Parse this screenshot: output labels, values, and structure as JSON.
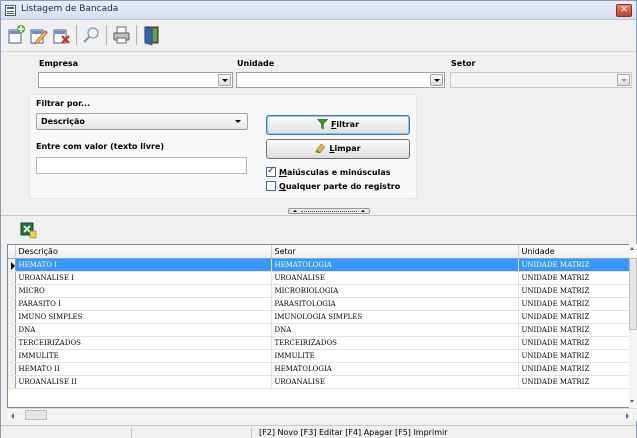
{
  "window": {
    "title": "Listagem de Bancada",
    "close_label": "✕"
  },
  "toolbar": {
    "buttons": [
      {
        "icon": "new-record-icon"
      },
      {
        "icon": "edit-record-icon"
      },
      {
        "icon": "delete-record-icon"
      },
      {
        "icon": "search-icon"
      },
      {
        "icon": "print-icon"
      },
      {
        "icon": "exit-door-icon"
      }
    ]
  },
  "filters": {
    "empresa_label": "Empresa",
    "unidade_label": "Unidade",
    "setor_label": "Setor",
    "empresa_value": "",
    "unidade_value": "",
    "setor_value": ""
  },
  "filter_panel": {
    "filtrar_por_label": "Filtrar por...",
    "filtrar_por_value": "Descrição",
    "valor_label": "Entre com valor (texto livre)",
    "valor_value": "",
    "filtrar_button": {
      "mnemonic": "F",
      "rest": "iltrar"
    },
    "limpar_button": {
      "mnemonic": "L",
      "rest": "impar"
    },
    "case_checkbox": {
      "mnemonic": "M",
      "rest": "aiúsculas e minúsculas",
      "checked": true
    },
    "anypart_checkbox": {
      "mnemonic": "Q",
      "rest": "ualquer parte do registro",
      "checked": false
    }
  },
  "grid": {
    "columns": [
      "Descrição",
      "Setor",
      "Unidade"
    ],
    "rows": [
      [
        "HEMATO I",
        "HEMATOLOGIA",
        "UNIDADE MATRIZ"
      ],
      [
        "UROANALISE I",
        "UROANALISE",
        "UNIDADE MATRIZ"
      ],
      [
        "MICRO",
        "MICROBIOLOGIA",
        "UNIDADE MATRIZ"
      ],
      [
        "PARASITO I",
        "PARASITOLOGIA",
        "UNIDADE MATRIZ"
      ],
      [
        "IMUNO SIMPLES",
        "IMUNOLOGIA SIMPLES",
        "UNIDADE MATRIZ"
      ],
      [
        "DNA",
        "DNA",
        "UNIDADE MATRIZ"
      ],
      [
        "TERCEIRIZADOS",
        "TERCEIRIZADOS",
        "UNIDADE MATRIZ"
      ],
      [
        "IMMULITE",
        "IMMULITE",
        "UNIDADE MATRIZ"
      ],
      [
        "HEMATO II",
        "HEMATOLOGIA",
        "UNIDADE MATRIZ"
      ],
      [
        "UROANALISE II",
        "UROANALISE",
        "UNIDADE MATRIZ"
      ]
    ],
    "selected_row": 0
  },
  "statusbar": {
    "text": "[F2] Novo [F3] Editar [F4] Apagar [F5] Imprimir"
  },
  "colors": {
    "selection": "#3399ff",
    "title_bg": "#d5dfee",
    "close": "#c0422a"
  }
}
